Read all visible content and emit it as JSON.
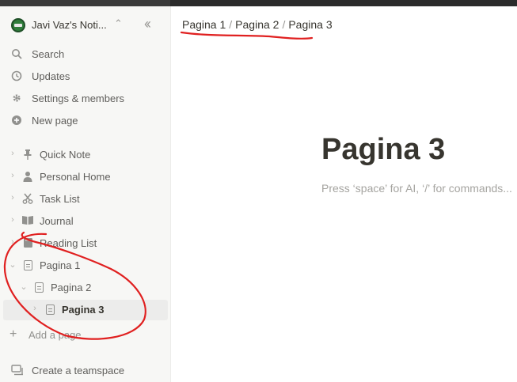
{
  "workspace": {
    "name": "Javi Vaz's Noti..."
  },
  "nav": [
    {
      "id": "search",
      "label": "Search",
      "icon": "search-icon"
    },
    {
      "id": "updates",
      "label": "Updates",
      "icon": "clock-icon"
    },
    {
      "id": "settings",
      "label": "Settings & members",
      "icon": "gear-icon"
    },
    {
      "id": "new-page",
      "label": "New page",
      "icon": "plus-circle-icon"
    }
  ],
  "pages": [
    {
      "label": "Quick Note",
      "icon": "pin-icon"
    },
    {
      "label": "Personal Home",
      "icon": "person-icon"
    },
    {
      "label": "Task List",
      "icon": "scissors-icon"
    },
    {
      "label": "Journal",
      "icon": "book-icon"
    },
    {
      "label": "Reading List",
      "icon": "bookmark-book-icon"
    },
    {
      "label": "Pagina 1",
      "icon": "document-icon"
    },
    {
      "label": "Pagina 2",
      "icon": "document-icon"
    },
    {
      "label": "Pagina 3",
      "icon": "document-icon"
    }
  ],
  "add_page": "Add a page",
  "teamspace": "Create a teamspace",
  "breadcrumb": {
    "item1": "Pagina 1",
    "item2": "Pagina 2",
    "item3": "Pagina 3",
    "sep": "/"
  },
  "page": {
    "title": "Pagina 3",
    "placeholder": "Press ‘space’ for AI, ‘/’ for commands..."
  },
  "colors": {
    "sidebar_bg": "#f7f7f5",
    "selected_bg": "#ececeb",
    "text": "#37352f",
    "annotation_red": "#e02020"
  }
}
